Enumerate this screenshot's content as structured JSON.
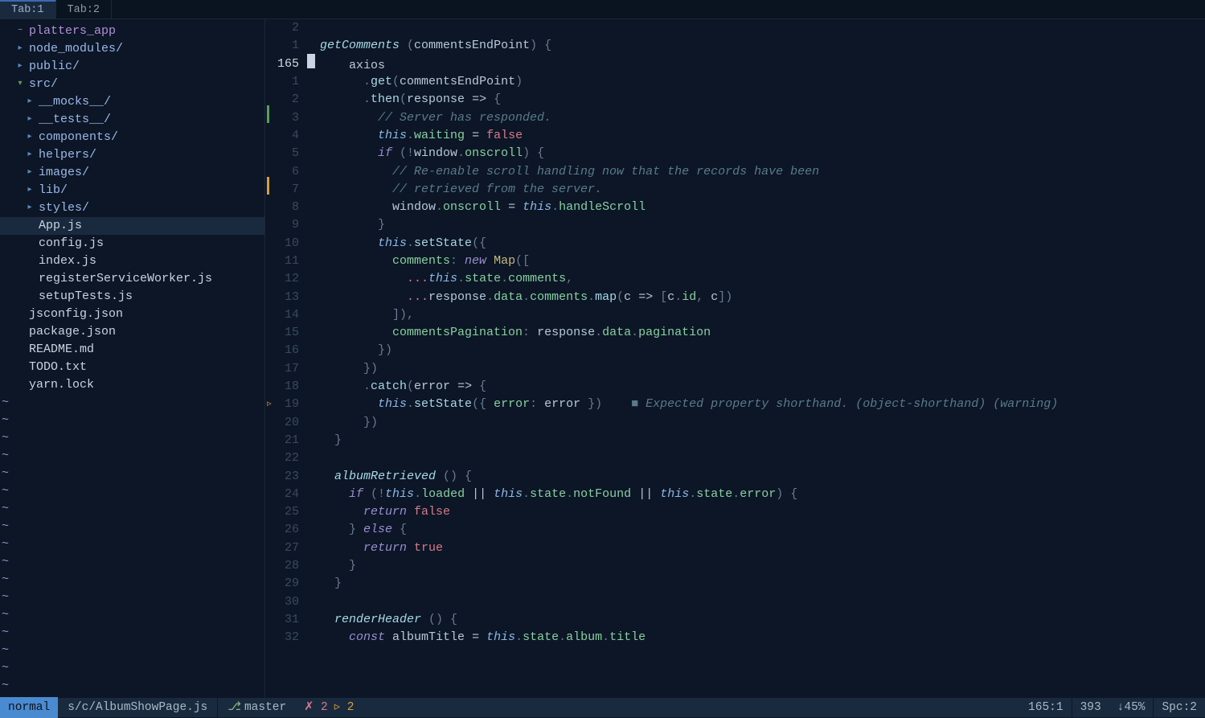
{
  "tabs": [
    {
      "label": "Tab:1",
      "active": true
    },
    {
      "label": "Tab:2",
      "active": false
    }
  ],
  "tree": [
    {
      "depth": 0,
      "icon": "root",
      "label": "platters_app",
      "kind": "root"
    },
    {
      "depth": 0,
      "icon": "closed",
      "label": "node_modules/",
      "kind": "dir"
    },
    {
      "depth": 0,
      "icon": "closed",
      "label": "public/",
      "kind": "dir"
    },
    {
      "depth": 0,
      "icon": "open",
      "label": "src/",
      "kind": "dir"
    },
    {
      "depth": 1,
      "icon": "closed",
      "label": "__mocks__/",
      "kind": "dir"
    },
    {
      "depth": 1,
      "icon": "closed",
      "label": "__tests__/",
      "kind": "dir"
    },
    {
      "depth": 1,
      "icon": "closed",
      "label": "components/",
      "kind": "dir"
    },
    {
      "depth": 1,
      "icon": "closed",
      "label": "helpers/",
      "kind": "dir"
    },
    {
      "depth": 1,
      "icon": "closed",
      "label": "images/",
      "kind": "dir"
    },
    {
      "depth": 1,
      "icon": "closed",
      "label": "lib/",
      "kind": "dir"
    },
    {
      "depth": 1,
      "icon": "closed",
      "label": "styles/",
      "kind": "dir"
    },
    {
      "depth": 1,
      "icon": "",
      "label": "App.js",
      "kind": "file",
      "selected": true
    },
    {
      "depth": 1,
      "icon": "",
      "label": "config.js",
      "kind": "file"
    },
    {
      "depth": 1,
      "icon": "",
      "label": "index.js",
      "kind": "file"
    },
    {
      "depth": 1,
      "icon": "",
      "label": "registerServiceWorker.js",
      "kind": "file"
    },
    {
      "depth": 1,
      "icon": "",
      "label": "setupTests.js",
      "kind": "file"
    },
    {
      "depth": 0,
      "icon": "",
      "label": "jsconfig.json",
      "kind": "file"
    },
    {
      "depth": 0,
      "icon": "",
      "label": "package.json",
      "kind": "file"
    },
    {
      "depth": 0,
      "icon": "",
      "label": "README.md",
      "kind": "file"
    },
    {
      "depth": 0,
      "icon": "",
      "label": "TODO.txt",
      "kind": "file"
    },
    {
      "depth": 0,
      "icon": "",
      "label": "yarn.lock",
      "kind": "file"
    }
  ],
  "gutter_numbers": [
    "2",
    "1",
    "165",
    "1",
    "2",
    "3",
    "4",
    "5",
    "6",
    "7",
    "8",
    "9",
    "10",
    "11",
    "12",
    "13",
    "14",
    "15",
    "16",
    "17",
    "18",
    "19",
    "20",
    "21",
    "22",
    "23",
    "24",
    "25",
    "26",
    "27",
    "28",
    "29",
    "30",
    "31",
    "32"
  ],
  "current_row_index": 2,
  "code": {
    "l0": "",
    "l1a": "getComments",
    "l1b": " (",
    "l1c": "commentsEndPoint",
    "l1d": ") {",
    "l2a": "    ",
    "l2b": "axios",
    "l3a": "      .",
    "l3b": "get",
    "l3c": "(",
    "l3d": "commentsEndPoint",
    "l3e": ")",
    "l4a": "      .",
    "l4b": "then",
    "l4c": "(",
    "l4d": "response",
    "l4e": " => ",
    "l4f": "{",
    "l5a": "        ",
    "l5b": "// Server has responded.",
    "l6a": "        ",
    "l6b": "this",
    "l6c": ".",
    "l6d": "waiting",
    "l6e": " = ",
    "l6f": "false",
    "l7a": "        ",
    "l7b": "if",
    "l7c": " (!",
    "l7d": "window",
    "l7e": ".",
    "l7f": "onscroll",
    "l7g": ") {",
    "l8a": "          ",
    "l8b": "// Re-enable scroll handling now that the records have been",
    "l9a": "          ",
    "l9b": "// retrieved from the server.",
    "l10a": "          ",
    "l10b": "window",
    "l10c": ".",
    "l10d": "onscroll",
    "l10e": " = ",
    "l10f": "this",
    "l10g": ".",
    "l10h": "handleScroll",
    "l11": "        }",
    "l12a": "        ",
    "l12b": "this",
    "l12c": ".",
    "l12d": "setState",
    "l12e": "({",
    "l13a": "          ",
    "l13b": "comments",
    "l13c": ": ",
    "l13d": "new",
    "l13e": " ",
    "l13f": "Map",
    "l13g": "([",
    "l14a": "            ",
    "l14b": "...",
    "l14c": "this",
    "l14d": ".",
    "l14e": "state",
    "l14f": ".",
    "l14g": "comments",
    "l14h": ",",
    "l15a": "            ",
    "l15b": "...",
    "l15c": "response",
    "l15d": ".",
    "l15e": "data",
    "l15f": ".",
    "l15g": "comments",
    "l15h": ".",
    "l15i": "map",
    "l15j": "(",
    "l15k": "c",
    "l15l": " => ",
    "l15m": "[",
    "l15n": "c",
    "l15o": ".",
    "l15p": "id",
    "l15q": ", ",
    "l15r": "c",
    "l15s": "])",
    "l16": "          ]),",
    "l17a": "          ",
    "l17b": "commentsPagination",
    "l17c": ": ",
    "l17d": "response",
    "l17e": ".",
    "l17f": "data",
    "l17g": ".",
    "l17h": "pagination",
    "l18": "        })",
    "l19": "      })",
    "l20a": "      .",
    "l20b": "catch",
    "l20c": "(",
    "l20d": "error",
    "l20e": " => ",
    "l20f": "{",
    "l21a": "        ",
    "l21b": "this",
    "l21c": ".",
    "l21d": "setState",
    "l21e": "({ ",
    "l21f": "error",
    "l21g": ": ",
    "l21h": "error",
    "l21i": " })",
    "l21pad": "    ",
    "l21mark": "■ ",
    "l21diag": "Expected property shorthand. (object-shorthand) (warning)",
    "l22": "      })",
    "l23": "  }",
    "l24": "",
    "l25a": "  ",
    "l25b": "albumRetrieved",
    "l25c": " () {",
    "l26a": "    ",
    "l26b": "if",
    "l26c": " (!",
    "l26d": "this",
    "l26e": ".",
    "l26f": "loaded",
    "l26g": " || ",
    "l26h": "this",
    "l26i": ".",
    "l26j": "state",
    "l26k": ".",
    "l26l": "notFound",
    "l26m": " || ",
    "l26n": "this",
    "l26o": ".",
    "l26p": "state",
    "l26q": ".",
    "l26r": "error",
    "l26s": ") {",
    "l27a": "      ",
    "l27b": "return",
    "l27c": " ",
    "l27d": "false",
    "l28a": "    } ",
    "l28b": "else",
    "l28c": " {",
    "l29a": "      ",
    "l29b": "return",
    "l29c": " ",
    "l29d": "true",
    "l30": "    }",
    "l31": "  }",
    "l32": "",
    "l33a": "  ",
    "l33b": "renderHeader",
    "l33c": " () {",
    "l34a": "    ",
    "l34b": "const",
    "l34c": " ",
    "l34d": "albumTitle",
    "l34e": " = ",
    "l34f": "this",
    "l34g": ".",
    "l34h": "state",
    "l34i": ".",
    "l34j": "album",
    "l34k": ".",
    "l34l": "title"
  },
  "status": {
    "mode": "normal",
    "path": "s/c/AlbumShowPage.js",
    "branch_icon": "⎇",
    "branch": "master",
    "err_prefix": "✗",
    "err_count": "2",
    "warn_prefix": "▹",
    "warn_count": "2",
    "pos": "165:1",
    "total": "393",
    "scroll": "↓45%",
    "indent": "Spc:2"
  },
  "tilde": "~"
}
